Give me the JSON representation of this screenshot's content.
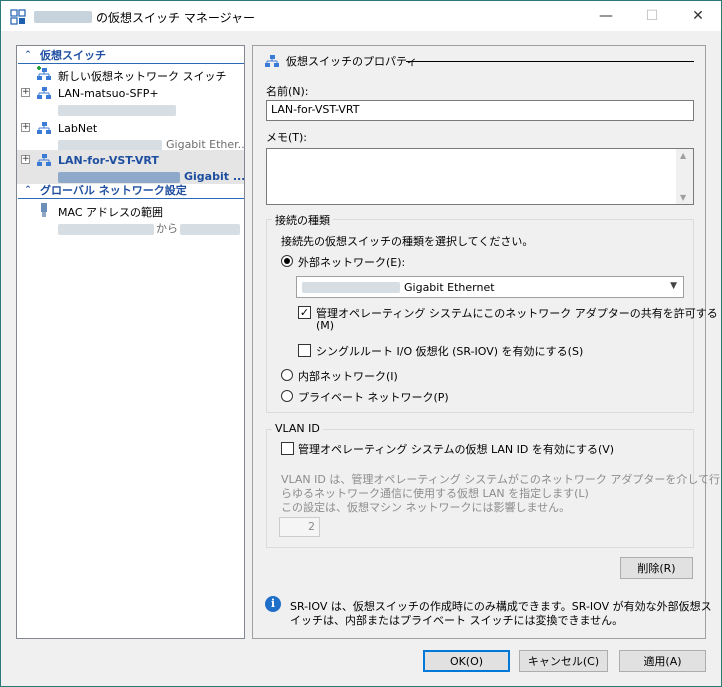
{
  "window": {
    "title": "の仮想スイッチ マネージャー",
    "controls": {
      "minimize": "—",
      "maximize": "☐",
      "close": "✕"
    }
  },
  "tree": {
    "virtual_switches_header": "仮想スイッチ",
    "new_switch": "新しい仮想ネットワーク スイッチ",
    "switches": [
      {
        "name": "LAN-matsuo-SFP+",
        "adapter": ""
      },
      {
        "name": "LabNet",
        "adapter": "Gigabit Ether..."
      },
      {
        "name": "LAN-for-VST-VRT",
        "adapter": "Gigabit ..."
      }
    ],
    "global_header": "グローバル ネットワーク設定",
    "mac_range": "MAC アドレスの範囲",
    "mac_range_sub": "から"
  },
  "properties": {
    "header": "仮想スイッチのプロパティ",
    "name_label": "名前(N):",
    "name_value": "LAN-for-VST-VRT",
    "memo_label": "メモ(T):",
    "conn_group": "接続の種類",
    "conn_desc": "接続先の仮想スイッチの種類を選択してください。",
    "external": "外部ネットワーク(E):",
    "adapter_selected": "Gigabit Ethernet",
    "allow_mgmt_os_line1": "管理オペレーティング システムにこのネットワーク アダプターの共有を許可する",
    "allow_mgmt_os_line2": "(M)",
    "sriov": "シングルルート I/O 仮想化 (SR-IOV) を有効にする(S)",
    "internal": "内部ネットワーク(I)",
    "private": "プライベート ネットワーク(P)",
    "vlan_group": "VLAN ID",
    "vlan_enable": "管理オペレーティング システムの仮想 LAN ID を有効にする(V)",
    "vlan_desc_1": "VLAN ID は、管理オペレーティング システムがこのネットワーク アダプターを介して行うあ",
    "vlan_desc_2": "らゆるネットワーク通信に使用する仮想 LAN を指定します(L)",
    "vlan_desc_3": "この設定は、仮想マシン ネットワークには影響しません。",
    "vlan_value": "2",
    "remove": "削除(R)",
    "info_line1": "SR-IOV は、仮想スイッチの作成時にのみ構成できます。SR-IOV が有効な外部仮想ス",
    "info_line2": "イッチは、内部またはプライベート スイッチには変換できません。"
  },
  "footer": {
    "ok": "OK(O)",
    "cancel": "キャンセル(C)",
    "apply": "適用(A)"
  }
}
